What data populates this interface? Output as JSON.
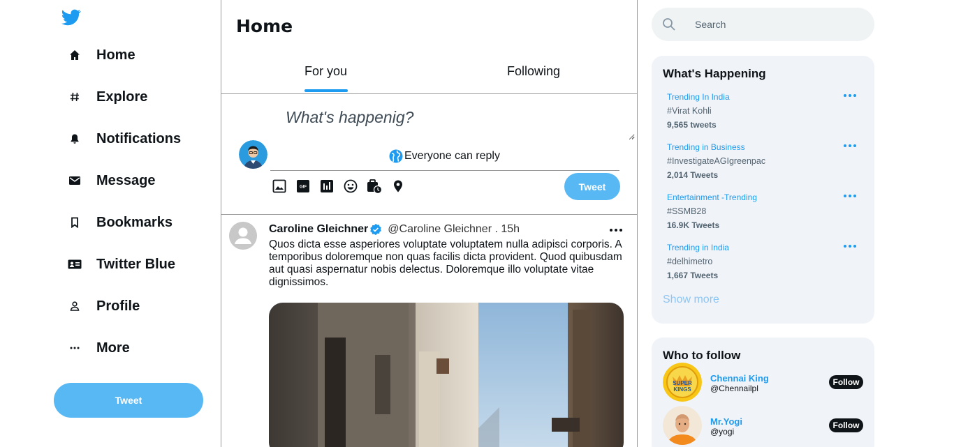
{
  "colors": {
    "accent": "#1d9bf0",
    "tweet_button": "#57b8f3",
    "card_background": "#f0f3f8"
  },
  "sidebar": {
    "logo_icon": "twitter-bird-icon",
    "items": [
      {
        "label": "Home",
        "icon": "home-icon"
      },
      {
        "label": "Explore",
        "icon": "hashtag-icon"
      },
      {
        "label": "Notifications",
        "icon": "bell-icon"
      },
      {
        "label": "Message",
        "icon": "envelope-icon"
      },
      {
        "label": "Bookmarks",
        "icon": "bookmark-icon"
      },
      {
        "label": "Twitter Blue",
        "icon": "id-card-icon"
      },
      {
        "label": "Profile",
        "icon": "person-icon"
      },
      {
        "label": "More",
        "icon": "more-dots-icon"
      }
    ],
    "tweet_button": "Tweet"
  },
  "main": {
    "title": "Home",
    "tabs": [
      {
        "label": "For you",
        "active": true
      },
      {
        "label": "Following",
        "active": false
      }
    ],
    "compose": {
      "placeholder": "What's happenig?",
      "reply_setting": "Everyone can reply",
      "tools": [
        "image-icon",
        "gif-icon",
        "poll-icon",
        "emoji-icon",
        "schedule-icon",
        "location-icon"
      ],
      "tweet_button": "Tweet"
    },
    "post": {
      "name": "Caroline Gleichner",
      "handle": "@Caroline Gleichner . 15h",
      "text": "Quos dicta esse asperiores voluptate voluptatem nulla adipisci corporis. A temporibus doloremque non quas facilis dicta provident. Quod quibusdam aut quasi aspernatur nobis delectus. Doloremque illo voluptate vitae dignissimos."
    }
  },
  "right": {
    "search": {
      "placeholder": "Search"
    },
    "trends": {
      "title": "What's Happening",
      "items": [
        {
          "category": "Trending In India",
          "name": "#Virat Kohli",
          "count": "9,565 tweets"
        },
        {
          "category": "Trending in Business",
          "name": "#InvestigateAGIgreenpac",
          "count": "2,014 Tweets"
        },
        {
          "category": "Entertainment -Trending",
          "name": "#SSMB28",
          "count": "16.9K Tweets"
        },
        {
          "category": "Trending in India",
          "name": "#delhimetro",
          "count": "1,667 Tweets"
        }
      ],
      "show_more": "Show more"
    },
    "who_to_follow": {
      "title": "Who to follow",
      "items": [
        {
          "name": "Chennai King",
          "handle": "@Chennailpl",
          "button": "Follow"
        },
        {
          "name": "Mr.Yogi",
          "handle": "@yogi",
          "button": "Follow"
        }
      ]
    }
  }
}
